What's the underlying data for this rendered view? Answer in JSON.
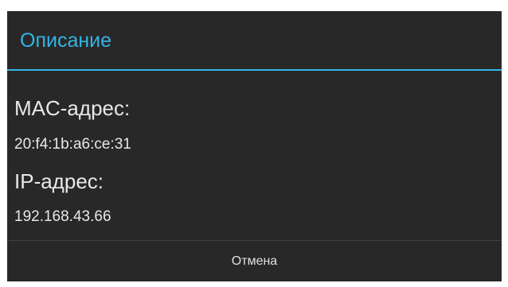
{
  "dialog": {
    "title": "Описание",
    "mac_label": "MAC-адрес:",
    "mac_value": "20:f4:1b:a6:ce:31",
    "ip_label": "IP-адрес:",
    "ip_value": "192.168.43.66",
    "cancel_label": "Отмена"
  },
  "colors": {
    "accent": "#33b5e5",
    "background": "#282828",
    "text": "#e8e8e8"
  }
}
